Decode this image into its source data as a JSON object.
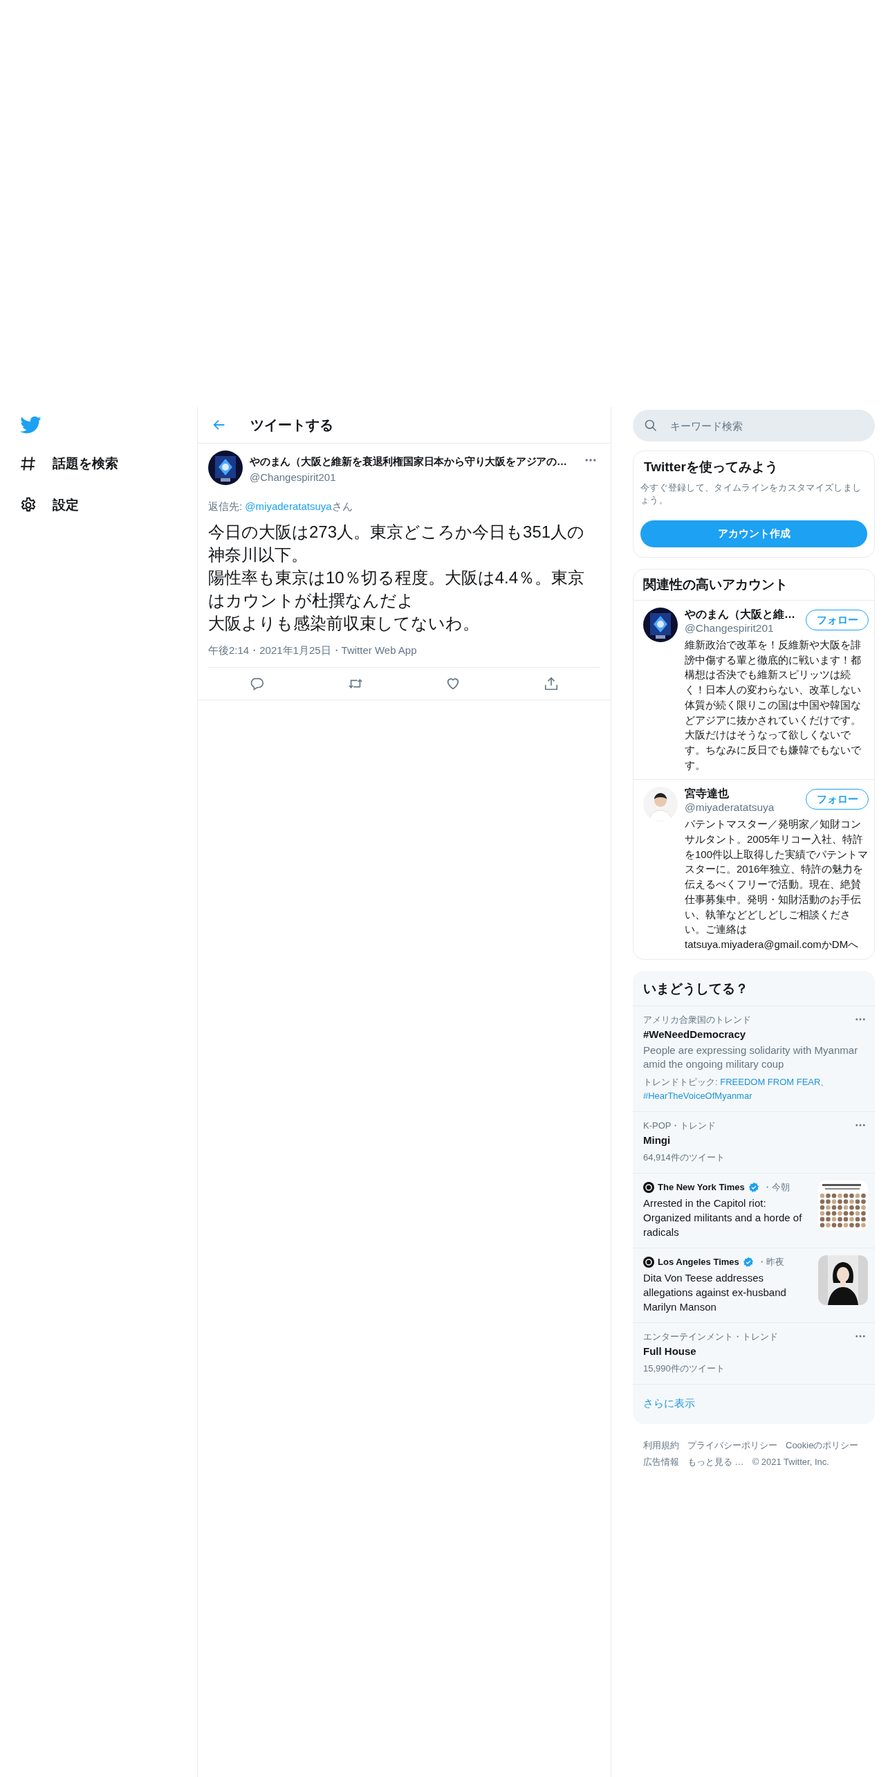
{
  "nav": {
    "items": [
      {
        "label": "話題を検索",
        "kind": "explore"
      },
      {
        "label": "設定",
        "kind": "settings"
      }
    ]
  },
  "header": {
    "title": "ツイートする"
  },
  "tweet": {
    "name": "やのまん（大阪と維新を衰退利権国家日本から守り大阪をアジアの…",
    "handle": "@Changespirit201",
    "reply_prefix": "返信先: ",
    "reply_to": "@miyaderatatsuya",
    "reply_suffix": "さん",
    "text": [
      "今日の大阪は273人。東京どころか今日も351人の神奈川以下。",
      "陽性率も東京は10％切る程度。大阪は4.4％。東京はカウントが杜撰なんだよ",
      "大阪よりも感染前収束してないわ。"
    ],
    "meta": "午後2:14・2021年1月25日・Twitter Web App"
  },
  "search": {
    "placeholder": "キーワード検索"
  },
  "signup": {
    "title": "Twitterを使ってみよう",
    "text": "今すぐ登録して、タイムラインをカスタマイズしましょう。",
    "button": "アカウント作成"
  },
  "follow": {
    "title": "関連性の高いアカウント",
    "accounts": [
      {
        "name": "やのまん（大阪と維…",
        "handle": "@Changespirit201",
        "button": "フォロー",
        "bio": "維新政治で改革を！反維新や大阪を誹謗中傷する輩と徹底的に戦います！都構想は否決でも維新スピリッツは続く！日本人の変わらない、改革しない体質が続く限りこの国は中国や韓国などアジアに抜かされていくだけです。大阪だけはそうなって欲しくないです。ちなみに反日でも嫌韓でもないです。"
      },
      {
        "name": "宮寺達也",
        "handle": "@miyaderatatsuya",
        "button": "フォロー",
        "bio": "パテントマスター／発明家／知財コンサルタント。2005年リコー入社、特許を100件以上取得した実績でパテントマスターに。2016年独立、特許の魅力を伝えるべくフリーで活動。現在、絶賛仕事募集中。発明・知財活動のお手伝い、執筆などどしどしご相談ください。ご連絡はtatsuya.miyadera@gmail.comかDMへ"
      }
    ]
  },
  "trends": {
    "title": "いまどうしてる？",
    "items": [
      {
        "kind": "trend",
        "context": "アメリカ合衆国のトレンド",
        "title": "#WeNeedDemocracy",
        "description": "People are expressing solidarity with Myanmar amid the ongoing military coup",
        "topics_label": "トレンドトピック: ",
        "topics": [
          "FREEDOM FROM FEAR、",
          "#HearTheVoiceOfMyanmar"
        ]
      },
      {
        "kind": "trend",
        "context": "K-POP・トレンド",
        "title": "Mingi",
        "count": "64,914件のツイート"
      },
      {
        "kind": "news",
        "source": "The New York Times",
        "verified": true,
        "time": "・今朝",
        "headline": "Arrested in the Capitol riot: Organized militants and a horde of radicals"
      },
      {
        "kind": "news",
        "source": "Los Angeles Times",
        "verified": true,
        "time": "・昨夜",
        "headline": "Dita Von Teese addresses allegations against ex-husband Marilyn Manson"
      },
      {
        "kind": "trend",
        "context": "エンターテインメント・トレンド",
        "title": "Full House",
        "count": "15,990件のツイート"
      }
    ],
    "show_more": "さらに表示"
  },
  "footer": {
    "links": [
      "利用規約",
      "プライバシーポリシー",
      "Cookieのポリシー",
      "広告情報",
      "もっと見る …",
      "© 2021 Twitter, Inc."
    ]
  }
}
